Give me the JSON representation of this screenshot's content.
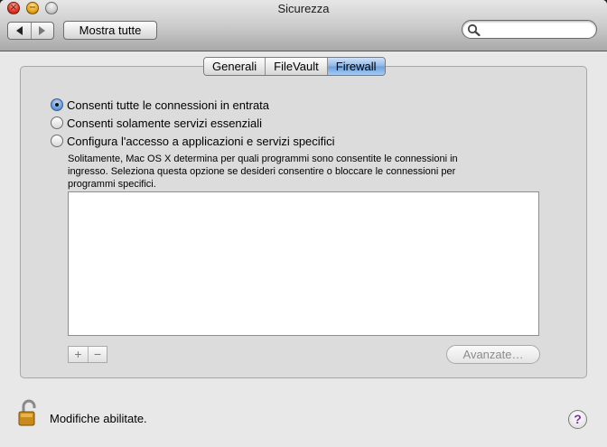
{
  "window": {
    "title": "Sicurezza"
  },
  "toolbar": {
    "back_icon": "arrow-left-icon",
    "forward_icon": "arrow-right-icon",
    "show_all_label": "Mostra tutte",
    "search": {
      "value": "",
      "placeholder": ""
    }
  },
  "tabs": [
    {
      "label": "Generali",
      "selected": false
    },
    {
      "label": "FileVault",
      "selected": false
    },
    {
      "label": "Firewall",
      "selected": true
    }
  ],
  "firewall": {
    "options": [
      {
        "label": "Consenti tutte le connessioni in entrata",
        "selected": true
      },
      {
        "label": "Consenti solamente servizi essenziali",
        "selected": false
      },
      {
        "label": "Configura l'accesso a applicazioni e servizi specifici",
        "selected": false
      }
    ],
    "description_lines": [
      "Solitamente, Mac OS X determina per quali programmi sono consentite le connessioni in",
      "ingresso. Seleziona questa opzione se desideri consentire o bloccare le connessioni per",
      "programmi specifici."
    ],
    "add_label": "+",
    "remove_label": "−",
    "advanced_label": "Avanzate…"
  },
  "footer": {
    "lock_icon": "unlocked-padlock-icon",
    "lock_status": "Modifiche abilitate.",
    "help_label": "?"
  },
  "colors": {
    "selected_tab": "#7aaae3",
    "help_glyph": "#7b2fa5",
    "close_button": "#e0321d",
    "minimize_button": "#e8a316"
  }
}
